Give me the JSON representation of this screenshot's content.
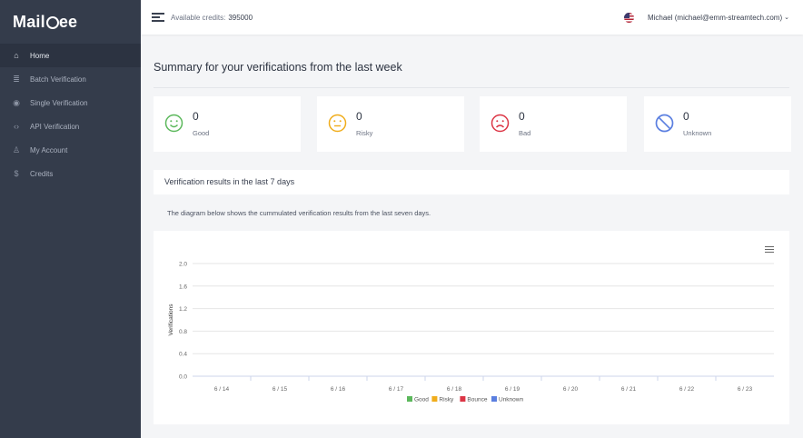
{
  "sidebar": {
    "brand_prefix": "Mail",
    "brand_suffix": "ee",
    "items": [
      {
        "label": "Home",
        "icon": "home-icon",
        "glyph": "⌂",
        "active": true
      },
      {
        "label": "Batch Verification",
        "icon": "database-icon",
        "glyph": "≣",
        "active": false
      },
      {
        "label": "Single Verification",
        "icon": "eye-icon",
        "glyph": "◉",
        "active": false
      },
      {
        "label": "API Verification",
        "icon": "code-icon",
        "glyph": "‹›",
        "active": false
      },
      {
        "label": "My Account",
        "icon": "user-icon",
        "glyph": "♙",
        "active": false
      },
      {
        "label": "Credits",
        "icon": "dollar-icon",
        "glyph": "$",
        "active": false
      }
    ]
  },
  "topbar": {
    "credits_label": "Available credits:",
    "credits_value": "395000",
    "user_label": "Michael (michael@emm-streamtech.com)"
  },
  "main": {
    "title": "Summary for your verifications from the last week",
    "stats": [
      {
        "count": "0",
        "label": "Good",
        "color": "#5cb85c",
        "icon": "smile-icon"
      },
      {
        "count": "0",
        "label": "Risky",
        "color": "#f0ad1c",
        "icon": "neutral-face-icon"
      },
      {
        "count": "0",
        "label": "Bad",
        "color": "#dc3545",
        "icon": "frown-icon"
      },
      {
        "count": "0",
        "label": "Unknown",
        "color": "#5b7fe0",
        "icon": "ban-icon"
      }
    ],
    "panel_title": "Verification results in the last 7 days",
    "panel_desc": "The diagram below shows the cummulated verification results from the last seven days."
  },
  "chart_data": {
    "type": "bar",
    "categories": [
      "6 / 14",
      "6 / 15",
      "6 / 16",
      "6 / 17",
      "6 / 18",
      "6 / 19",
      "6 / 20",
      "6 / 21",
      "6 / 22",
      "6 / 23"
    ],
    "series": [
      {
        "name": "Good",
        "color": "#5cb85c",
        "values": [
          0,
          0,
          0,
          0,
          0,
          0,
          0,
          0,
          0,
          0
        ]
      },
      {
        "name": "Risky",
        "color": "#f0ad1c",
        "values": [
          0,
          0,
          0,
          0,
          0,
          0,
          0,
          0,
          0,
          0
        ]
      },
      {
        "name": "Bounce",
        "color": "#dc3545",
        "values": [
          0,
          0,
          0,
          0,
          0,
          0,
          0,
          0,
          0,
          0
        ]
      },
      {
        "name": "Unknown",
        "color": "#5b7fe0",
        "values": [
          0,
          0,
          0,
          0,
          0,
          0,
          0,
          0,
          0,
          0
        ]
      }
    ],
    "yticks": [
      "0.0",
      "0.4",
      "0.8",
      "1.2",
      "1.6",
      "2.0"
    ],
    "ylim": [
      0,
      2
    ],
    "ylabel": "Verifications",
    "xlabel": "",
    "grid": true,
    "legend": "bottom"
  }
}
